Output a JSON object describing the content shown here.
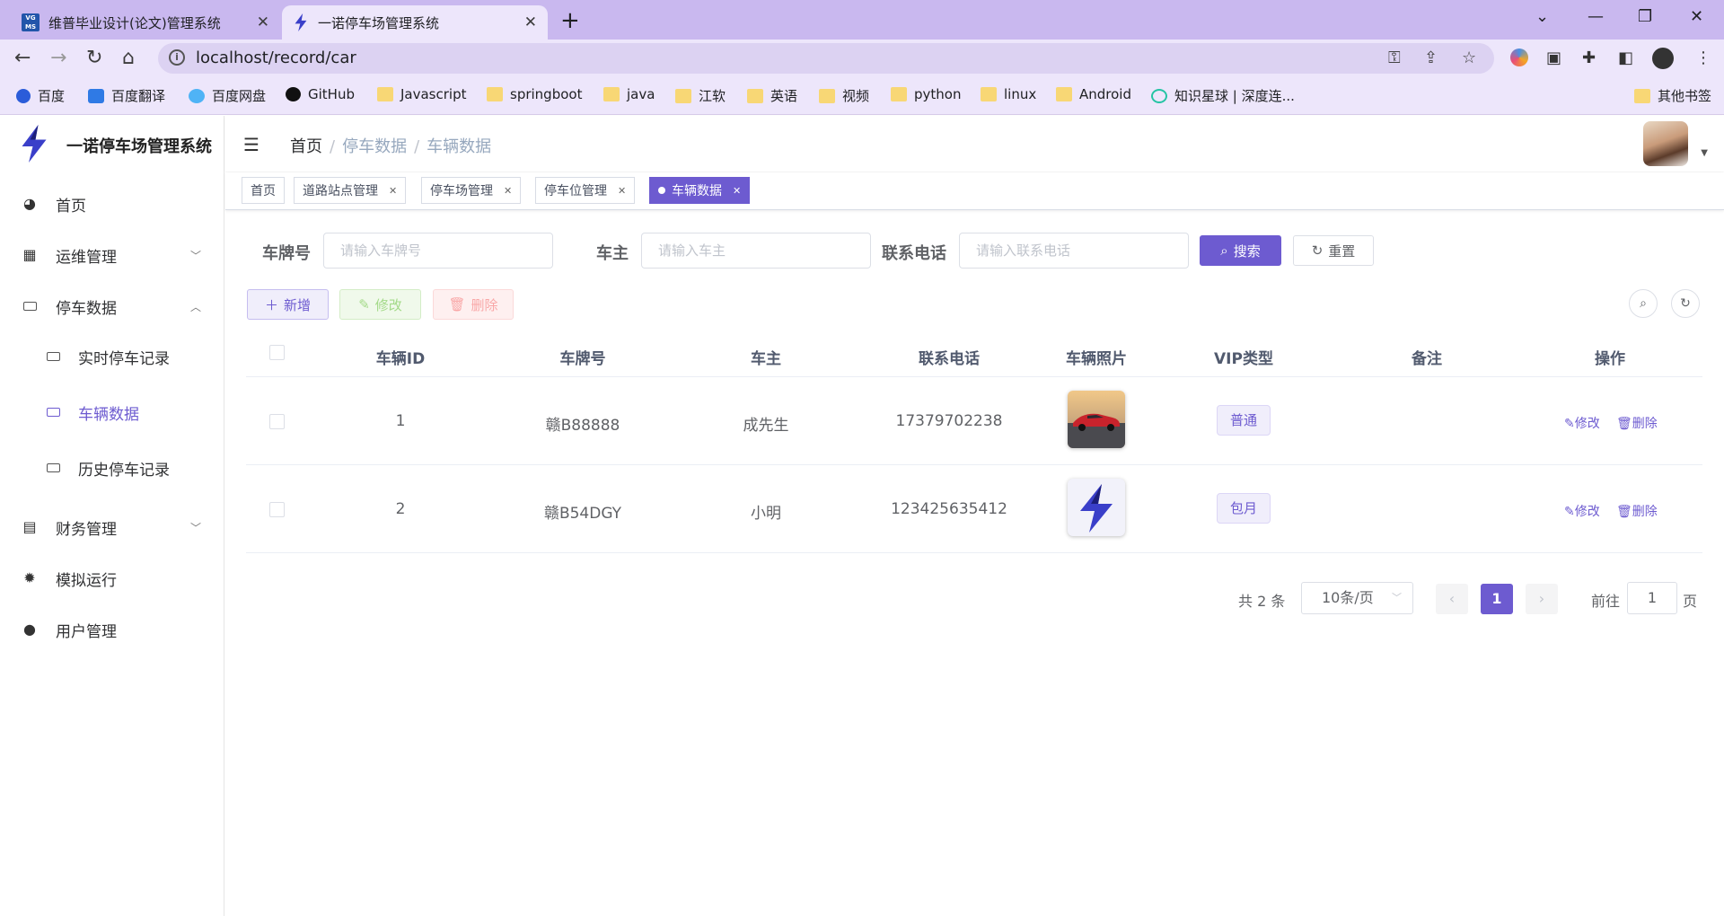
{
  "browser": {
    "tabs": [
      {
        "title": "维普毕业设计(论文)管理系统",
        "favicon": "vg-icon",
        "active": false
      },
      {
        "title": "一诺停车场管理系统",
        "favicon": "bolt-icon",
        "active": true
      }
    ],
    "url": "localhost/record/car",
    "bookmarks": [
      {
        "label": "百度",
        "icon": "baidu-icon"
      },
      {
        "label": "百度翻译",
        "icon": "translate-icon"
      },
      {
        "label": "百度网盘",
        "icon": "cloud-icon"
      },
      {
        "label": "GitHub",
        "icon": "github-icon"
      },
      {
        "label": "Javascript",
        "icon": "folder-icon"
      },
      {
        "label": "springboot",
        "icon": "folder-icon"
      },
      {
        "label": "java",
        "icon": "folder-icon"
      },
      {
        "label": "江软",
        "icon": "folder-icon"
      },
      {
        "label": "英语",
        "icon": "folder-icon"
      },
      {
        "label": "视频",
        "icon": "folder-icon"
      },
      {
        "label": "python",
        "icon": "folder-icon"
      },
      {
        "label": "linux",
        "icon": "folder-icon"
      },
      {
        "label": "Android",
        "icon": "folder-icon"
      },
      {
        "label": "知识星球 | 深度连...",
        "icon": "zsxq-icon"
      }
    ],
    "other_bookmarks": "其他书签"
  },
  "app": {
    "title": "一诺停车场管理系统",
    "accent": "#6d5bd0",
    "sidebar": {
      "items": [
        {
          "label": "首页",
          "icon": "dashboard-icon"
        },
        {
          "label": "运维管理",
          "icon": "table-icon",
          "expanded": false
        },
        {
          "label": "停车数据",
          "icon": "card-icon",
          "expanded": true
        },
        {
          "label": "实时停车记录",
          "icon": "card-icon"
        },
        {
          "label": "车辆数据",
          "icon": "card-icon",
          "active": true
        },
        {
          "label": "历史停车记录",
          "icon": "card-icon"
        },
        {
          "label": "财务管理",
          "icon": "document-icon",
          "expanded": false
        },
        {
          "label": "模拟运行",
          "icon": "bug-icon"
        },
        {
          "label": "用户管理",
          "icon": "user-icon"
        }
      ]
    },
    "breadcrumb": [
      "首页",
      "停车数据",
      "车辆数据"
    ],
    "tags": [
      {
        "label": "首页",
        "closable": false
      },
      {
        "label": "道路站点管理",
        "closable": true
      },
      {
        "label": "停车场管理",
        "closable": true
      },
      {
        "label": "停车位管理",
        "closable": true
      },
      {
        "label": "车辆数据",
        "closable": true,
        "active": true
      }
    ],
    "search": {
      "plate_label": "车牌号",
      "plate_placeholder": "请输入车牌号",
      "owner_label": "车主",
      "owner_placeholder": "请输入车主",
      "phone_label": "联系电话",
      "phone_placeholder": "请输入联系电话",
      "search_btn": "搜索",
      "reset_btn": "重置"
    },
    "actions": {
      "add": "新增",
      "edit": "修改",
      "delete": "删除"
    },
    "table": {
      "columns": [
        "车辆ID",
        "车牌号",
        "车主",
        "联系电话",
        "车辆照片",
        "VIP类型",
        "备注",
        "操作"
      ],
      "rows": [
        {
          "id": "1",
          "plate": "赣B88888",
          "owner": "成先生",
          "phone": "17379702238",
          "photo": "red-car-photo",
          "vip": "普通",
          "note": "",
          "edit": "修改",
          "delete": "删除"
        },
        {
          "id": "2",
          "plate": "赣B54DGY",
          "owner": "小明",
          "phone": "123425635412",
          "photo": "bolt-logo-photo",
          "vip": "包月",
          "note": "",
          "edit": "修改",
          "delete": "删除"
        }
      ]
    },
    "pagination": {
      "total_text": "共 2 条",
      "page_size": "10条/页",
      "current_page": "1",
      "goto_label": "前往",
      "goto_value": "1",
      "page_suffix": "页"
    }
  }
}
